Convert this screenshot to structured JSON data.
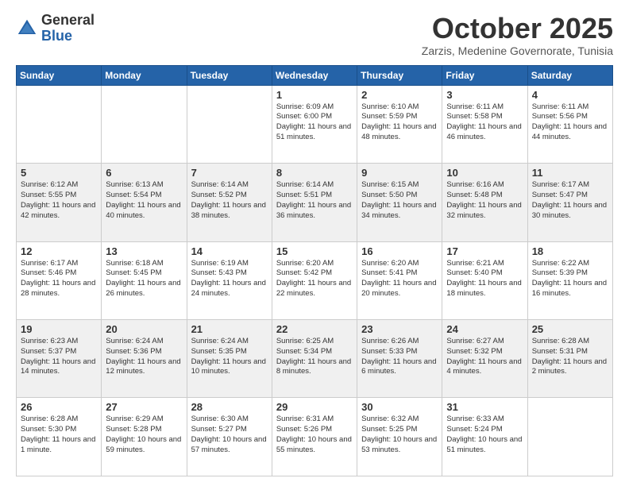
{
  "logo": {
    "general": "General",
    "blue": "Blue"
  },
  "header": {
    "month": "October 2025",
    "location": "Zarzis, Medenine Governorate, Tunisia"
  },
  "weekdays": [
    "Sunday",
    "Monday",
    "Tuesday",
    "Wednesday",
    "Thursday",
    "Friday",
    "Saturday"
  ],
  "weeks": [
    [
      {
        "day": "",
        "text": ""
      },
      {
        "day": "",
        "text": ""
      },
      {
        "day": "",
        "text": ""
      },
      {
        "day": "1",
        "text": "Sunrise: 6:09 AM\nSunset: 6:00 PM\nDaylight: 11 hours and 51 minutes."
      },
      {
        "day": "2",
        "text": "Sunrise: 6:10 AM\nSunset: 5:59 PM\nDaylight: 11 hours and 48 minutes."
      },
      {
        "day": "3",
        "text": "Sunrise: 6:11 AM\nSunset: 5:58 PM\nDaylight: 11 hours and 46 minutes."
      },
      {
        "day": "4",
        "text": "Sunrise: 6:11 AM\nSunset: 5:56 PM\nDaylight: 11 hours and 44 minutes."
      }
    ],
    [
      {
        "day": "5",
        "text": "Sunrise: 6:12 AM\nSunset: 5:55 PM\nDaylight: 11 hours and 42 minutes."
      },
      {
        "day": "6",
        "text": "Sunrise: 6:13 AM\nSunset: 5:54 PM\nDaylight: 11 hours and 40 minutes."
      },
      {
        "day": "7",
        "text": "Sunrise: 6:14 AM\nSunset: 5:52 PM\nDaylight: 11 hours and 38 minutes."
      },
      {
        "day": "8",
        "text": "Sunrise: 6:14 AM\nSunset: 5:51 PM\nDaylight: 11 hours and 36 minutes."
      },
      {
        "day": "9",
        "text": "Sunrise: 6:15 AM\nSunset: 5:50 PM\nDaylight: 11 hours and 34 minutes."
      },
      {
        "day": "10",
        "text": "Sunrise: 6:16 AM\nSunset: 5:48 PM\nDaylight: 11 hours and 32 minutes."
      },
      {
        "day": "11",
        "text": "Sunrise: 6:17 AM\nSunset: 5:47 PM\nDaylight: 11 hours and 30 minutes."
      }
    ],
    [
      {
        "day": "12",
        "text": "Sunrise: 6:17 AM\nSunset: 5:46 PM\nDaylight: 11 hours and 28 minutes."
      },
      {
        "day": "13",
        "text": "Sunrise: 6:18 AM\nSunset: 5:45 PM\nDaylight: 11 hours and 26 minutes."
      },
      {
        "day": "14",
        "text": "Sunrise: 6:19 AM\nSunset: 5:43 PM\nDaylight: 11 hours and 24 minutes."
      },
      {
        "day": "15",
        "text": "Sunrise: 6:20 AM\nSunset: 5:42 PM\nDaylight: 11 hours and 22 minutes."
      },
      {
        "day": "16",
        "text": "Sunrise: 6:20 AM\nSunset: 5:41 PM\nDaylight: 11 hours and 20 minutes."
      },
      {
        "day": "17",
        "text": "Sunrise: 6:21 AM\nSunset: 5:40 PM\nDaylight: 11 hours and 18 minutes."
      },
      {
        "day": "18",
        "text": "Sunrise: 6:22 AM\nSunset: 5:39 PM\nDaylight: 11 hours and 16 minutes."
      }
    ],
    [
      {
        "day": "19",
        "text": "Sunrise: 6:23 AM\nSunset: 5:37 PM\nDaylight: 11 hours and 14 minutes."
      },
      {
        "day": "20",
        "text": "Sunrise: 6:24 AM\nSunset: 5:36 PM\nDaylight: 11 hours and 12 minutes."
      },
      {
        "day": "21",
        "text": "Sunrise: 6:24 AM\nSunset: 5:35 PM\nDaylight: 11 hours and 10 minutes."
      },
      {
        "day": "22",
        "text": "Sunrise: 6:25 AM\nSunset: 5:34 PM\nDaylight: 11 hours and 8 minutes."
      },
      {
        "day": "23",
        "text": "Sunrise: 6:26 AM\nSunset: 5:33 PM\nDaylight: 11 hours and 6 minutes."
      },
      {
        "day": "24",
        "text": "Sunrise: 6:27 AM\nSunset: 5:32 PM\nDaylight: 11 hours and 4 minutes."
      },
      {
        "day": "25",
        "text": "Sunrise: 6:28 AM\nSunset: 5:31 PM\nDaylight: 11 hours and 2 minutes."
      }
    ],
    [
      {
        "day": "26",
        "text": "Sunrise: 6:28 AM\nSunset: 5:30 PM\nDaylight: 11 hours and 1 minute."
      },
      {
        "day": "27",
        "text": "Sunrise: 6:29 AM\nSunset: 5:28 PM\nDaylight: 10 hours and 59 minutes."
      },
      {
        "day": "28",
        "text": "Sunrise: 6:30 AM\nSunset: 5:27 PM\nDaylight: 10 hours and 57 minutes."
      },
      {
        "day": "29",
        "text": "Sunrise: 6:31 AM\nSunset: 5:26 PM\nDaylight: 10 hours and 55 minutes."
      },
      {
        "day": "30",
        "text": "Sunrise: 6:32 AM\nSunset: 5:25 PM\nDaylight: 10 hours and 53 minutes."
      },
      {
        "day": "31",
        "text": "Sunrise: 6:33 AM\nSunset: 5:24 PM\nDaylight: 10 hours and 51 minutes."
      },
      {
        "day": "",
        "text": ""
      }
    ]
  ]
}
